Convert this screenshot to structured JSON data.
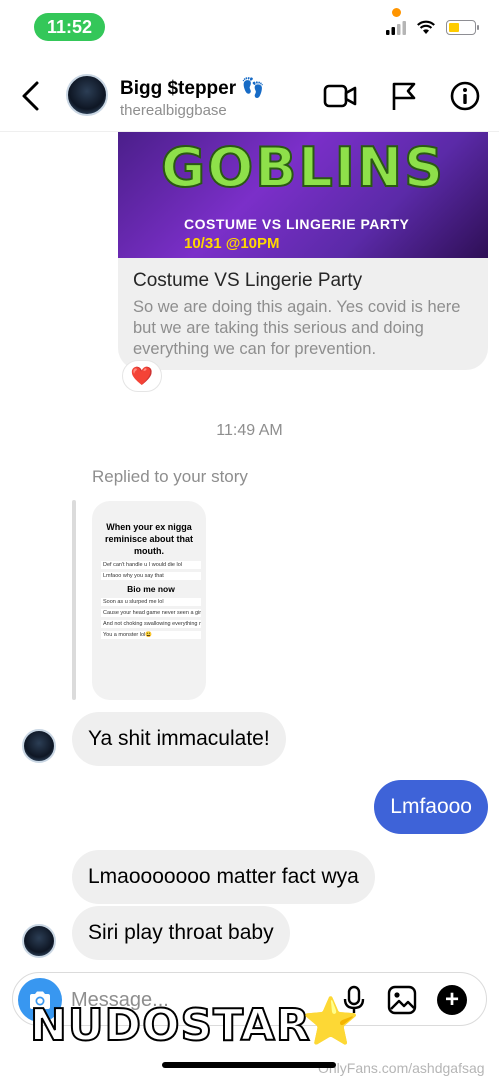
{
  "status_bar": {
    "time": "11:52"
  },
  "header": {
    "display_name": "Bigg $tepper 👣",
    "username": "therealbiggbase",
    "icons": [
      "back-chevron-icon",
      "video-call-icon",
      "flag-icon",
      "info-icon"
    ]
  },
  "shared_card": {
    "image_text": {
      "headline": "GOBLINS",
      "subline": "COSTUME VS LINGERIE PARTY",
      "date": "10/31 @10PM"
    },
    "title": "Costume VS Lingerie Party",
    "description": "So we are doing this again. Yes covid is here but we are taking this serious and doing everything we can for prevention.",
    "reaction": "❤️"
  },
  "timestamp": "11:49 AM",
  "story_reply": {
    "label": "Replied to your story",
    "story_heading": "When your ex nigga reminisce about that mouth.",
    "story_bio": "Bio me now",
    "story_lines": [
      "Def can't handle u I would die lol",
      "Lmfaoo why you say that",
      "Soon as u slurped me lol",
      "Cause your head game never seen a girl do it like that",
      "And not choking swallowing everything no gag reflex",
      "You a monster lol😩"
    ]
  },
  "messages": [
    {
      "side": "in",
      "text": "Ya shit immaculate!"
    },
    {
      "side": "out",
      "text": "Lmfaooo"
    },
    {
      "side": "in",
      "text": "Lmaooooooo matter fact wya"
    },
    {
      "side": "in",
      "text": "Siri play throat baby"
    }
  ],
  "composer": {
    "placeholder": "Message...",
    "icons": [
      "camera-icon",
      "microphone-icon",
      "gallery-icon",
      "plus-icon"
    ]
  },
  "colors": {
    "outgoing_bubble": "#3e63d8",
    "incoming_bubble": "#efefef",
    "camera_button": "#3897f0",
    "status_time_pill": "#34c759"
  },
  "watermarks": {
    "logo_text": "NUDOSTAR",
    "logo_star": "⭐",
    "url": "OnlyFans.com/ashdgafsag"
  }
}
